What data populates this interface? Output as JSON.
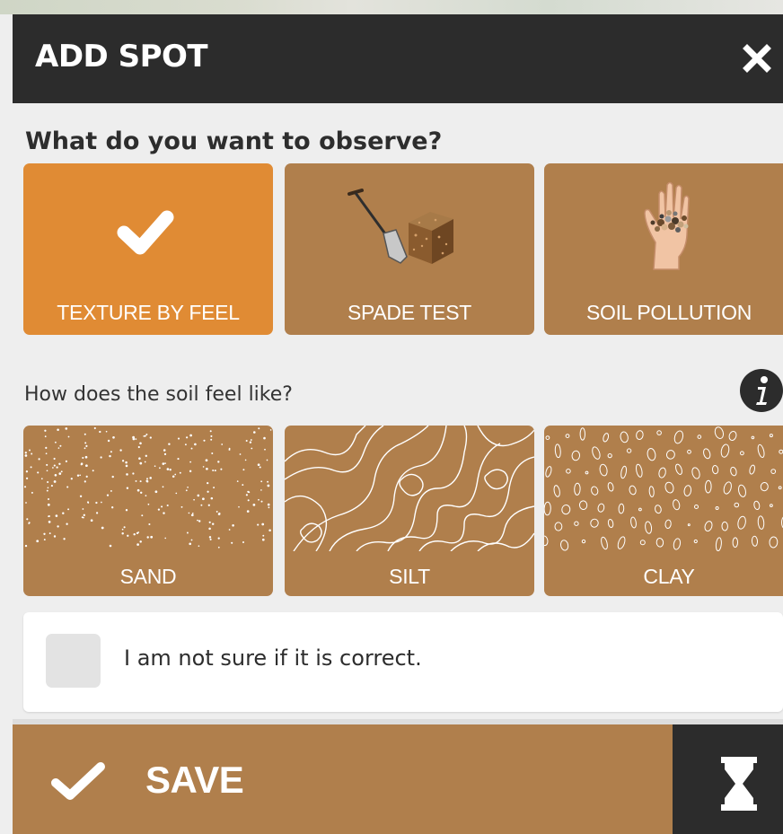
{
  "header": {
    "title": "ADD SPOT",
    "close_icon": "close-icon"
  },
  "observe": {
    "question": "What do you want to observe?",
    "options": [
      {
        "label": "TEXTURE BY FEEL",
        "selected": true,
        "icon": "checkmark-icon"
      },
      {
        "label": "SPADE TEST",
        "selected": false,
        "icon": "spade-test-icon"
      },
      {
        "label": "SOIL POLLUTION",
        "selected": false,
        "icon": "hand-soil-icon"
      }
    ]
  },
  "texture": {
    "question": "How does the soil feel like?",
    "info_icon": "info-icon",
    "options": [
      {
        "label": "SAND",
        "pattern": "dots"
      },
      {
        "label": "SILT",
        "pattern": "contour-lines"
      },
      {
        "label": "CLAY",
        "pattern": "ovals"
      }
    ]
  },
  "unsure": {
    "label": "I am not sure if it is correct.",
    "checked": false
  },
  "footer": {
    "save_label": "SAVE",
    "save_icon": "checkmark-icon",
    "pending_icon": "hourglass-icon"
  },
  "colors": {
    "header_bg": "#2c2c2c",
    "tile_bg": "#b07f4c",
    "tile_selected_bg": "#e08b34",
    "panel_bg": "#eeeeee"
  }
}
